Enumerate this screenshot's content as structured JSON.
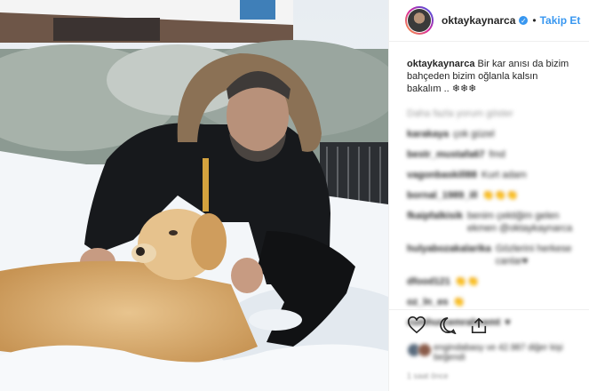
{
  "post": {
    "username": "oktaykaynarca",
    "follow_label": "Takip Et",
    "caption_user": "oktaykaynarca",
    "caption_text": "Bir kar anısı da bizim bahçeden bizim oğlanla kalsın bakalım .. ❄❄❄",
    "load_more": "Daha fazla yorum göster",
    "comments": [
      {
        "user": "karakaya",
        "text": "çok güzel"
      },
      {
        "user": "bestr_mustafa67",
        "text": "fmd"
      },
      {
        "user": "vagonbaskill88",
        "text": "Kurt adam"
      },
      {
        "user": "bornal_1989_ill",
        "text": "👏👏👏"
      },
      {
        "user": "fkaipfalkisik",
        "text": "benim çektiğim gelen ekmen @oktaykaynarca"
      },
      {
        "user": "hulyabozakalarika",
        "text": "Gözlerini herkese canlar♥"
      },
      {
        "user": "dfood121",
        "text": "👏👏"
      },
      {
        "user": "oz_ln_es",
        "text": "👏"
      },
      {
        "user": "cumhurcemrahcemt",
        "text": "♥"
      }
    ],
    "likes_text": "engindabasy ve 42.987 diğer kişi beğendi",
    "time_text": "1 saat önce"
  },
  "colors": {
    "accent": "#3897f0",
    "text": "#262626",
    "muted": "#999999"
  },
  "icons": [
    "verified-badge-icon",
    "heart-icon",
    "comment-icon",
    "share-icon"
  ]
}
